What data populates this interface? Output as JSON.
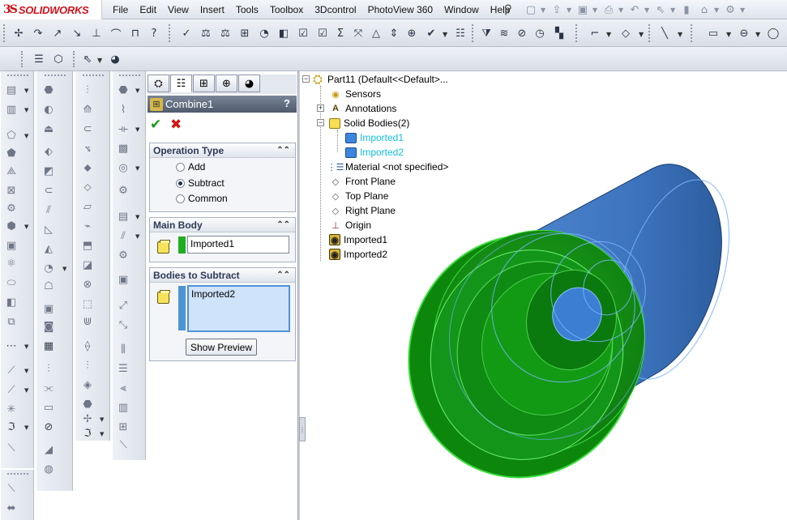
{
  "app": {
    "brand_mark": "3S",
    "brand_name": "SOLIDWORKS"
  },
  "menu": {
    "items": [
      "File",
      "Edit",
      "View",
      "Insert",
      "Tools",
      "Toolbox",
      "3Dcontrol",
      "PhotoView 360",
      "Window",
      "Help"
    ]
  },
  "property_manager": {
    "title": "Combine1",
    "help": "?",
    "ok": "✔",
    "cancel": "✖",
    "operation_type": {
      "heading": "Operation Type",
      "collapse": "⌃⌃",
      "options": [
        "Add",
        "Subtract",
        "Common"
      ],
      "selected": "Subtract"
    },
    "main_body": {
      "heading": "Main Body",
      "collapse": "⌃⌃",
      "value": "Imported1",
      "swatch_color": "#1fae1f"
    },
    "bodies_to_subtract": {
      "heading": "Bodies to Subtract",
      "collapse": "⌃⌃",
      "value": "Imported2",
      "swatch_color": "#4e93d7"
    },
    "show_preview": "Show Preview"
  },
  "feature_tree": {
    "root": "Part11  (Default<<Default>...",
    "nodes": {
      "sensors": "Sensors",
      "annotations": "Annotations",
      "solid_bodies": "Solid Bodies(2)",
      "imported1_body": "Imported1",
      "imported2_body": "Imported2",
      "material": "Material <not specified>",
      "front_plane": "Front Plane",
      "top_plane": "Top Plane",
      "right_plane": "Right Plane",
      "origin": "Origin",
      "imported1_feature": "Imported1",
      "imported2_feature": "Imported2"
    }
  },
  "colors": {
    "brand": "#d0121b",
    "main_body_green": "#1fae1f",
    "subtract_body_blue": "#3d7ad0",
    "tree_selected_cyan": "#11bfe0"
  }
}
